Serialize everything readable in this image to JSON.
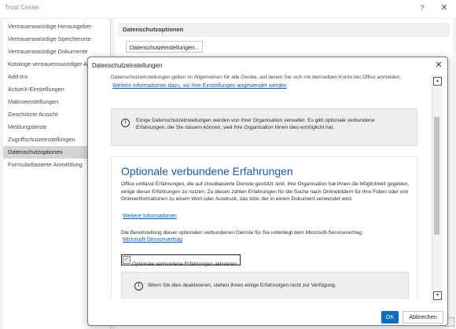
{
  "trust_center": {
    "title": "Trust Center",
    "help_label": "?",
    "close_label": "✕",
    "sidebar": {
      "items": [
        {
          "label": "Vertrauenswürdige Herausgeber"
        },
        {
          "label": "Vertrauenswürdige Speicherorte"
        },
        {
          "label": "Vertrauenswürdige Dokumente"
        },
        {
          "label": "Kataloge vertrauenswürdiger Add-Ins"
        },
        {
          "label": "Add-Ins"
        },
        {
          "label": "ActiveX-Einstellungen"
        },
        {
          "label": "Makroeinstellungen"
        },
        {
          "label": "Geschützte Ansicht"
        },
        {
          "label": "Meldungsleiste"
        },
        {
          "label": "Zugriffschutzeinstellungen"
        },
        {
          "label": "Datenschutzoptionen"
        },
        {
          "label": "Formularbasierte Anmeldung"
        }
      ],
      "selected_index": 10
    },
    "main": {
      "section_title": "Datenschutzoptionen",
      "button_label": "Datenschutzeinstellungen..."
    }
  },
  "dialog": {
    "title": "Datenschutzeinstellungen",
    "close_label": "✕",
    "intro_text": "Datenschutzeinstellungen gelten im Allgemeinen für alle Geräte, auf denen Sie sich mit demselben Konto bei Office anmelden.",
    "intro_link": "Weitere Informationen dazu, wo Ihre Einstellungen angewendet werden",
    "info_icon": "info-icon",
    "info_text": "Einige Datenschutzeinstellungen werden von Ihrer Organisation verwaltet. Es gibt optionale verbundene Erfahrungen, die Sie steuern können, weil Ihre Organisation Ihnen dies ermöglicht hat.",
    "optional": {
      "title": "Optionale verbundene Erfahrungen",
      "description": "Office umfasst Erfahrungen, die auf cloudbasierte Dienste gestützt sind. Ihre Organisation hat Ihnen die Möglichkeit gegeben, einige dieser Erfahrungen zu nutzen. Zu diesen zählen Erfahrungen für die Suche nach Onlinebildern für Ihre Folien oder von Onlineinformationen zu einem Wort oder Ausdruck, das bzw. der in einem Dokument verwendet wird.",
      "link_more": "Weitere Informationen",
      "service_sentence": "Die Bereitstellung dieser optionalen verbundenen Dienste für Sie unterliegt dem Microsoft-Servicevertrag.",
      "service_link": "Microsoft-Servicevertrag",
      "checkbox_label": "Optionale verbundene Erfahrungen aktivieren",
      "checkbox_checked": true,
      "checkbox_mark": "✓",
      "warning_text": "Wenn Sie dies deaktivieren, stehen Ihnen einige Erfahrungen nicht zur Verfügung."
    },
    "scroll_up_glyph": "▲",
    "scroll_down_glyph": "▼",
    "ok_label": "OK",
    "cancel_label": "Abbrechen"
  },
  "colors": {
    "accent": "#0f6cbd",
    "link": "#1a5ba6",
    "selected_item": "#d4d4d4"
  }
}
